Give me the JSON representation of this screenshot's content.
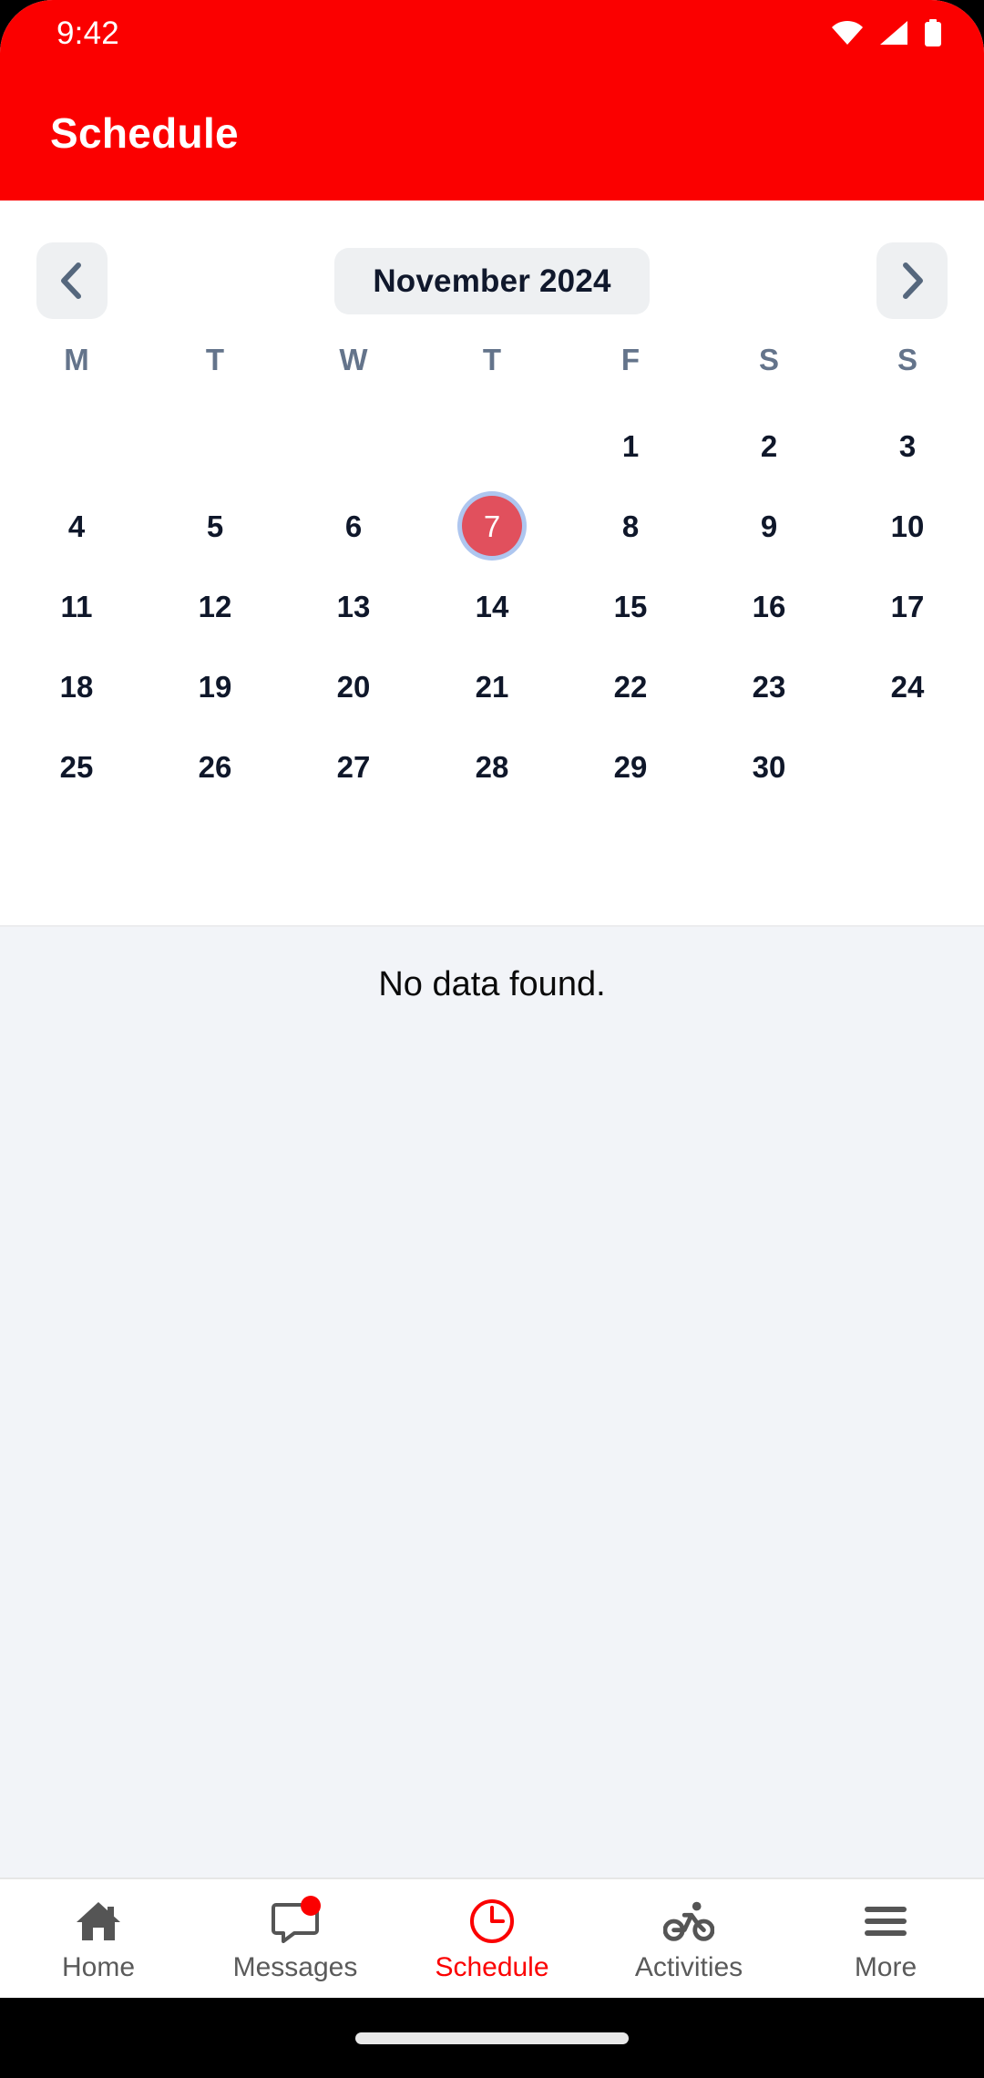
{
  "theme": {
    "brand_color": "#fb0000",
    "selected_day_fill": "#e1505d",
    "selected_day_ring": "#aec6ef",
    "content_bg": "#f2f4f8",
    "pill_bg": "#eef0f2",
    "weekday_color": "#64748b"
  },
  "status_bar": {
    "time": "9:42",
    "icons": [
      "wifi-icon",
      "signal-icon",
      "battery-icon"
    ]
  },
  "app_bar": {
    "title": "Schedule"
  },
  "calendar": {
    "prev_label": "chevron-left-icon",
    "next_label": "chevron-right-icon",
    "month_label": "November 2024",
    "weekdays": [
      "M",
      "T",
      "W",
      "T",
      "F",
      "S",
      "S"
    ],
    "selected_day": 7,
    "weeks": [
      [
        "",
        "",
        "",
        "",
        "1",
        "2",
        "3"
      ],
      [
        "4",
        "5",
        "6",
        "7",
        "8",
        "9",
        "10"
      ],
      [
        "11",
        "12",
        "13",
        "14",
        "15",
        "16",
        "17"
      ],
      [
        "18",
        "19",
        "20",
        "21",
        "22",
        "23",
        "24"
      ],
      [
        "25",
        "26",
        "27",
        "28",
        "29",
        "30",
        ""
      ]
    ]
  },
  "content": {
    "empty_message": "No data found."
  },
  "tab_bar": {
    "active_index": 2,
    "tabs": [
      {
        "label": "Home",
        "icon": "home-icon",
        "badge": false
      },
      {
        "label": "Messages",
        "icon": "message-icon",
        "badge": true
      },
      {
        "label": "Schedule",
        "icon": "clock-icon",
        "badge": false
      },
      {
        "label": "Activities",
        "icon": "bicycle-icon",
        "badge": false
      },
      {
        "label": "More",
        "icon": "hamburger-icon",
        "badge": false
      }
    ]
  }
}
